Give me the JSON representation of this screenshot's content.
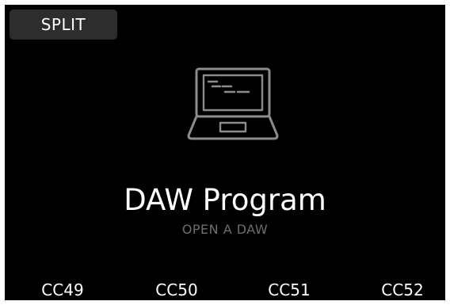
{
  "header": {
    "split_label": "SPLIT"
  },
  "main": {
    "icon": "laptop-icon",
    "title": "DAW Program",
    "subtitle": "OPEN A DAW"
  },
  "footer": {
    "cc_labels": [
      "CC49",
      "CC50",
      "CC51",
      "CC52"
    ]
  },
  "colors": {
    "background": "#000000",
    "button_background": "#2d2d2d",
    "text_primary": "#ffffff",
    "text_secondary": "#6e6e6e",
    "icon_stroke": "#8c8c8c"
  }
}
